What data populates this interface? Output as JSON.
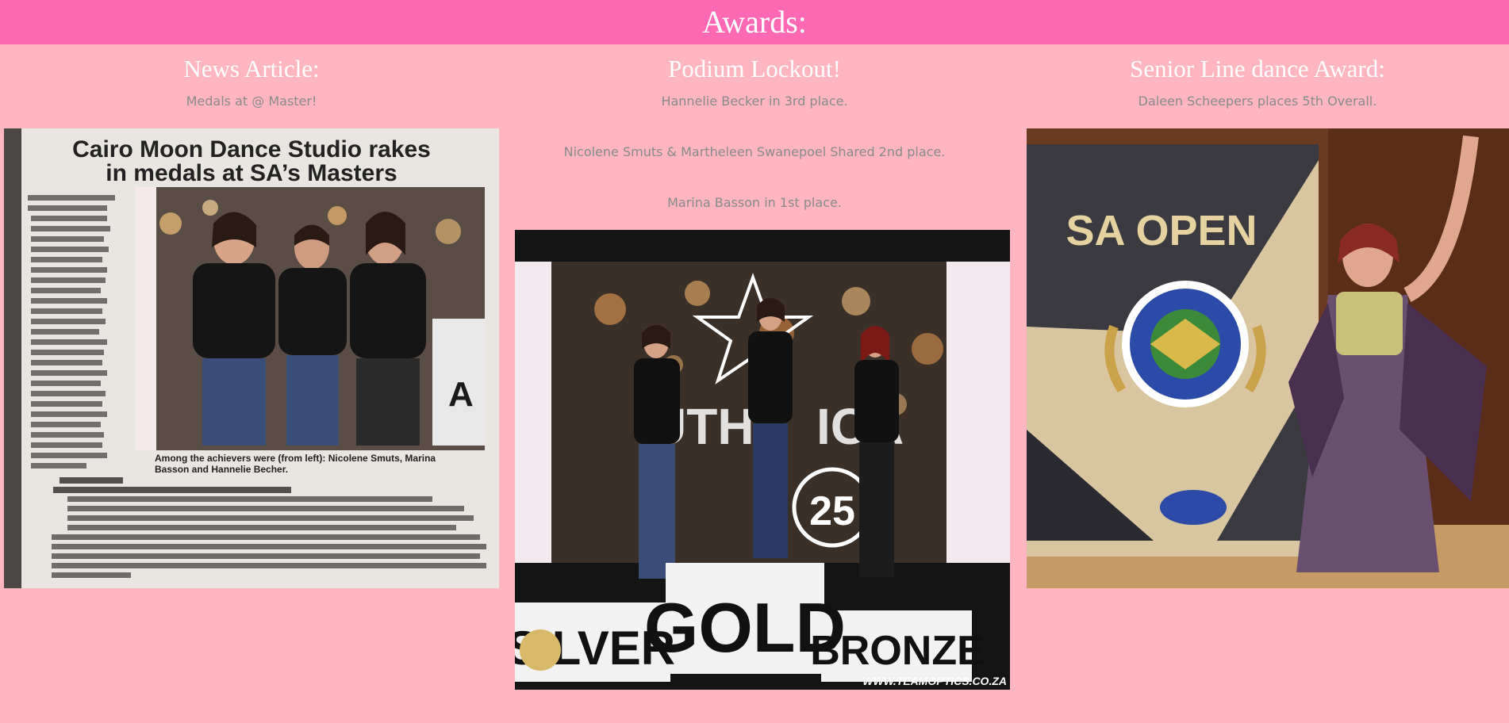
{
  "header": {
    "title": "Awards:"
  },
  "columns": [
    {
      "title": "News Article:",
      "lines": [
        "Medals at @ Master!"
      ],
      "photo": {
        "headline_1": "Cairo Moon Dance Studio rakes",
        "headline_2": "in medals at SA’s Masters",
        "caption_1": "Among the achievers were (from left): Nicolene Smuts, Marina",
        "caption_2": "Basson and Hannelie Becher."
      }
    },
    {
      "title": "Podium Lockout!",
      "lines": [
        "Hannelie Becker in 3rd place.",
        "Nicolene Smuts & Martheleen Swanepoel Shared 2nd place.",
        "Marina Basson in 1st place."
      ],
      "photo": {
        "silver": "SILVER",
        "gold": "GOLD",
        "bronze": "BRONZE",
        "credit": "WWW.TEAMOPTICS.CO.ZA"
      }
    },
    {
      "title": "Senior Line dance Award:",
      "lines": [
        "Daleen Scheepers places 5th Overall."
      ],
      "photo": {
        "banner": "SA OPEN"
      }
    }
  ],
  "colors": {
    "page_background": "#ffb6c1",
    "header_background": "#ff69b4",
    "heading_text": "#ffffff",
    "body_text": "#8a8a8a"
  }
}
